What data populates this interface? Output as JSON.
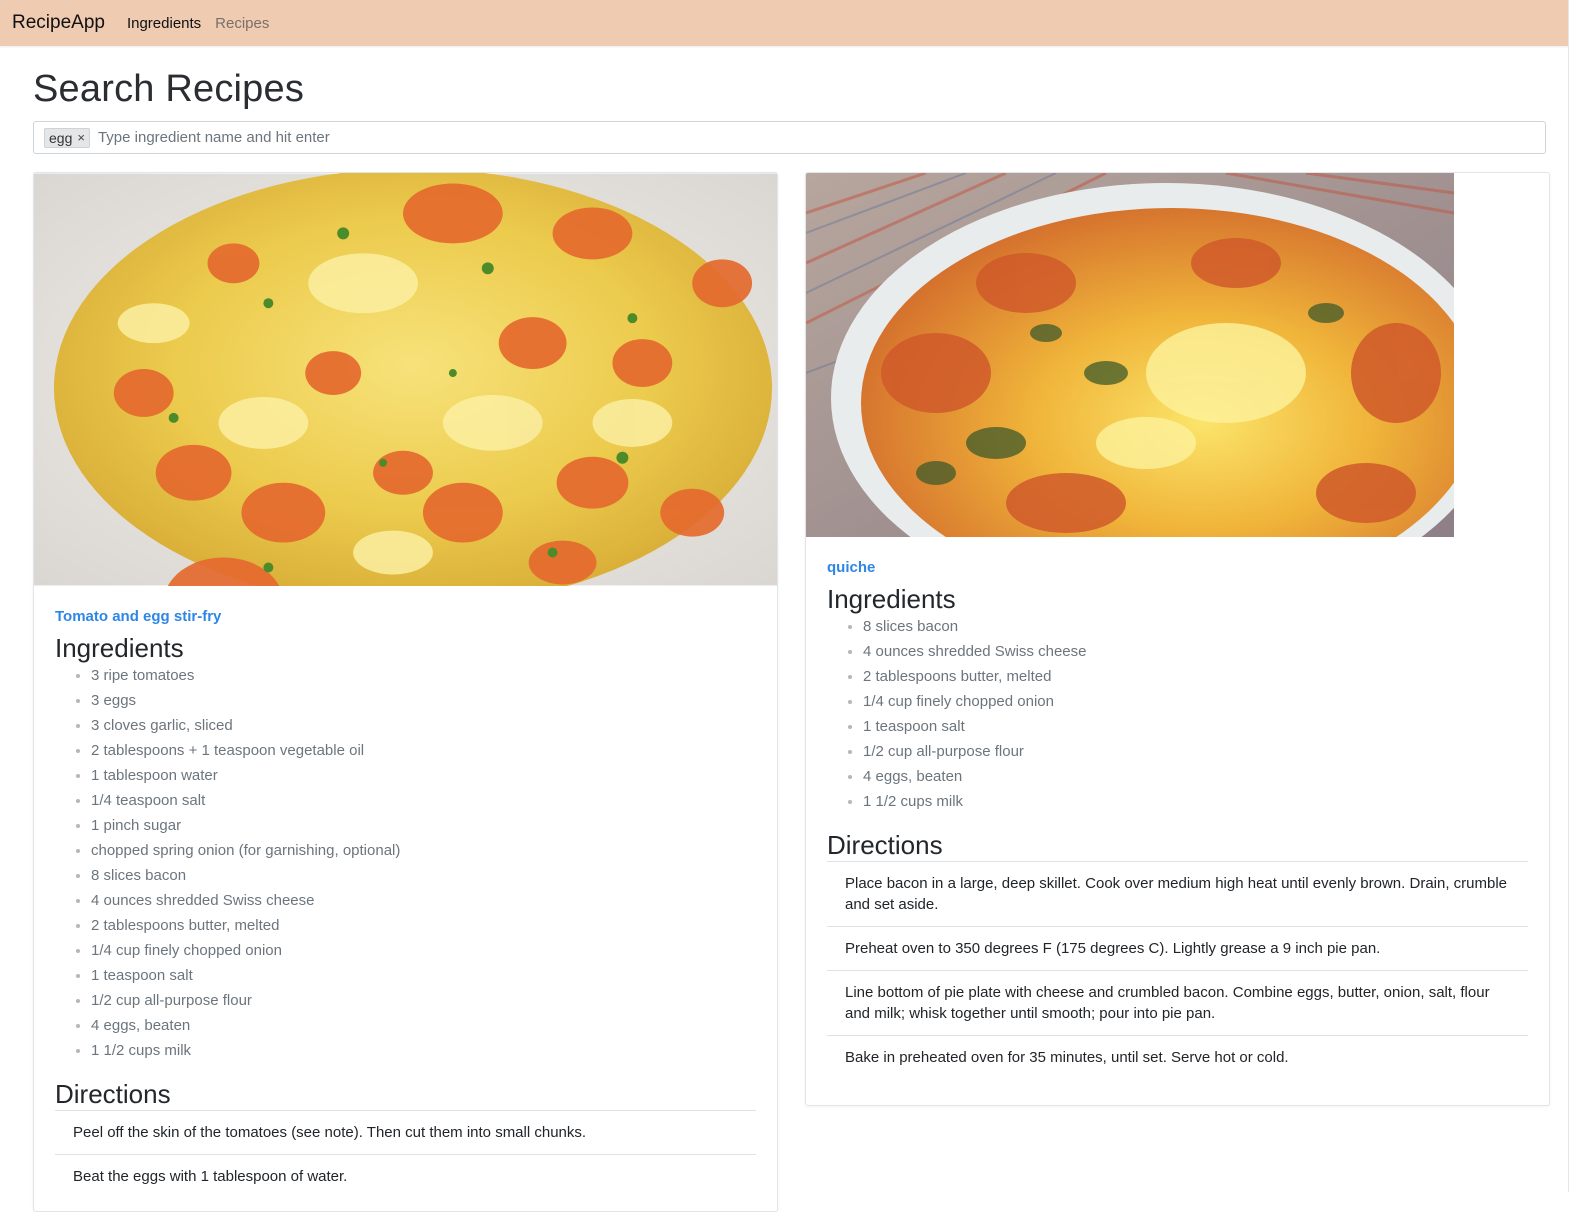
{
  "navbar": {
    "brand": "RecipeApp",
    "links": [
      {
        "label": "Ingredients",
        "active": true
      },
      {
        "label": "Recipes",
        "active": false
      }
    ],
    "background": "#eecbb1"
  },
  "page": {
    "title": "Search Recipes"
  },
  "search": {
    "tags": [
      {
        "label": "egg",
        "remove": "×"
      }
    ],
    "placeholder": "Type ingredient name and hit enter"
  },
  "recipes": [
    {
      "title": "Tomato and egg stir-fry",
      "image": "scrambled-egg-tomato-photo",
      "ingredients_heading": "Ingredients",
      "ingredients": [
        "3 ripe tomatoes",
        "3 eggs",
        "3 cloves garlic, sliced",
        "2 tablespoons + 1 teaspoon vegetable oil",
        "1 tablespoon water",
        "1/4 teaspoon salt",
        "1 pinch sugar",
        "chopped spring onion (for garnishing, optional)",
        "8 slices bacon",
        "4 ounces shredded Swiss cheese",
        "2 tablespoons butter, melted",
        "1/4 cup finely chopped onion",
        "1 teaspoon salt",
        "1/2 cup all-purpose flour",
        "4 eggs, beaten",
        "1 1/2 cups milk"
      ],
      "directions_heading": "Directions",
      "directions": [
        "Peel off the skin of the tomatoes (see note). Then cut them into small chunks.",
        "Beat the eggs with 1 tablespoon of water."
      ]
    },
    {
      "title": "quiche",
      "image": "quiche-photo",
      "ingredients_heading": "Ingredients",
      "ingredients": [
        "8 slices bacon",
        "4 ounces shredded Swiss cheese",
        "2 tablespoons butter, melted",
        "1/4 cup finely chopped onion",
        "1 teaspoon salt",
        "1/2 cup all-purpose flour",
        "4 eggs, beaten",
        "1 1/2 cups milk"
      ],
      "directions_heading": "Directions",
      "directions": [
        "Place bacon in a large, deep skillet. Cook over medium high heat until evenly brown. Drain, crumble and set aside.",
        "Preheat oven to 350 degrees F (175 degrees C). Lightly grease a 9 inch pie pan.",
        "Line bottom of pie plate with cheese and crumbled bacon. Combine eggs, butter, onion, salt, flour and milk; whisk together until smooth; pour into pie pan.",
        "Bake in preheated oven for 35 minutes, until set. Serve hot or cold."
      ]
    }
  ],
  "colors": {
    "link": "#2e86e6",
    "muted_text": "#6c757d"
  }
}
